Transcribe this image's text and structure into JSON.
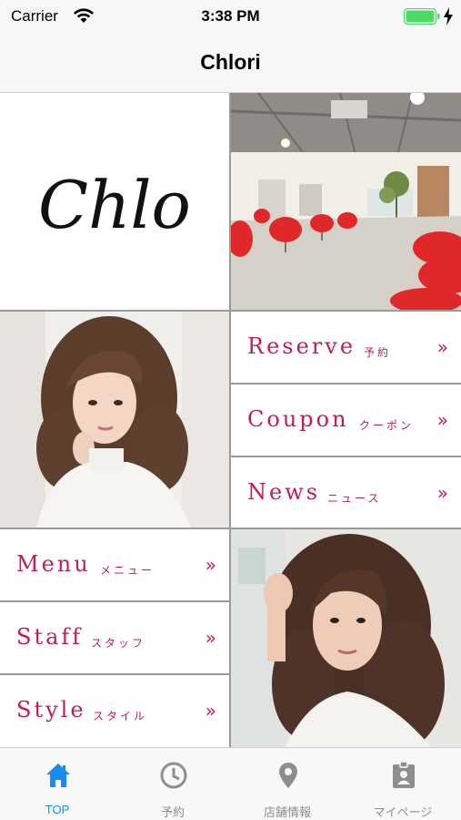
{
  "status_bar": {
    "carrier": "Carrier",
    "time": "3:38 PM"
  },
  "nav": {
    "title": "Chlori"
  },
  "logo": {
    "text": "Chlori"
  },
  "menu": {
    "reserve": {
      "en": "Reserve",
      "jp": "予約",
      "arrow": "»"
    },
    "coupon": {
      "en": "Coupon",
      "jp": "クーポン",
      "arrow": "»"
    },
    "news": {
      "en": "News",
      "jp": "ニュース",
      "arrow": "»"
    },
    "menu": {
      "en": "Menu",
      "jp": "メニュー",
      "arrow": "»"
    },
    "staff": {
      "en": "Staff",
      "jp": "スタッフ",
      "arrow": "»"
    },
    "style": {
      "en": "Style",
      "jp": "スタイル",
      "arrow": "»"
    }
  },
  "tabs": [
    {
      "label": "TOP",
      "icon": "home-icon",
      "active": true
    },
    {
      "label": "予約",
      "icon": "clock-icon",
      "active": false
    },
    {
      "label": "店舗情報",
      "icon": "map-pin-icon",
      "active": false
    },
    {
      "label": "マイページ",
      "icon": "id-card-icon",
      "active": false
    }
  ],
  "colors": {
    "accent": "#c1204e",
    "tab_active": "#1a8cf0",
    "tab_inactive": "#8e8e8e",
    "battery": "#4cd964"
  }
}
